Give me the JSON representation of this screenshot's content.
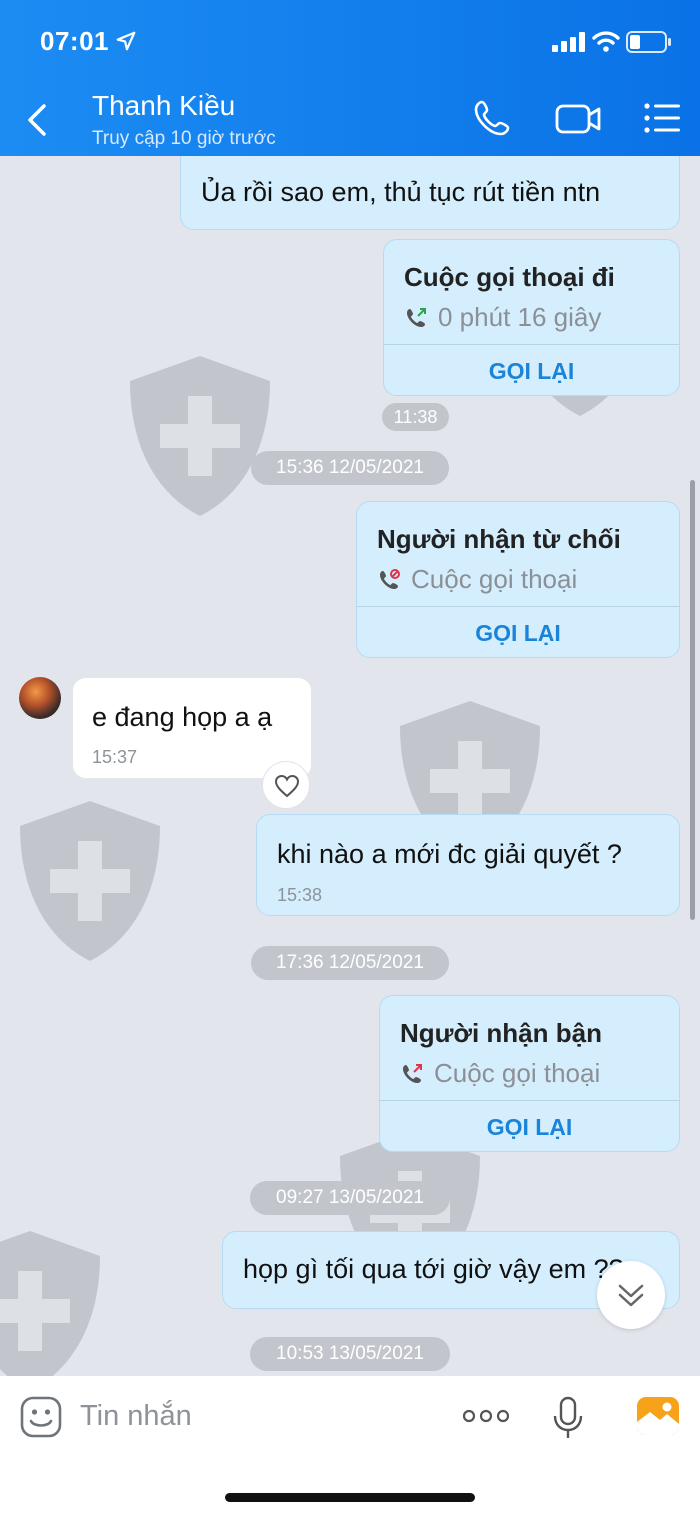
{
  "status_bar": {
    "time": "07:01"
  },
  "header": {
    "contact_name": "Thanh Kiều",
    "contact_status": "Truy cập 10 giờ trước",
    "icons": [
      "back-icon",
      "phone-icon",
      "video-icon",
      "menu-icon"
    ]
  },
  "messages": {
    "m1": {
      "text": "Ủa rồi sao em, thủ tục rút tiền ntn"
    },
    "call1": {
      "title": "Cuộc gọi thoại đi",
      "subtitle": "0 phút 16 giây",
      "action": "GỌI LẠI"
    },
    "time_1138": "11:38",
    "sep1": "15:36 12/05/2021",
    "call2": {
      "title": "Người nhận từ chối",
      "subtitle": "Cuộc gọi thoại",
      "action": "GỌI LẠI"
    },
    "m2": {
      "text": "e đang họp a ạ",
      "time": "15:37"
    },
    "m3": {
      "text": "khi nào a mới đc giải quyết ?",
      "time": "15:38"
    },
    "sep2": "17:36 12/05/2021",
    "call3": {
      "title": "Người nhận bận",
      "subtitle": "Cuộc gọi thoại",
      "action": "GỌI LẠI"
    },
    "sep3": "09:27 13/05/2021",
    "m4": {
      "text": "họp gì tối qua tới giờ vậy em ??"
    },
    "sep4": "10:53 13/05/2021"
  },
  "input_bar": {
    "placeholder": "Tin nhắn"
  },
  "colors": {
    "header": "#1c8cf3",
    "outgoing_bubble": "#d5eefd",
    "action": "#1a84d8",
    "background": "#e2e6ec"
  }
}
